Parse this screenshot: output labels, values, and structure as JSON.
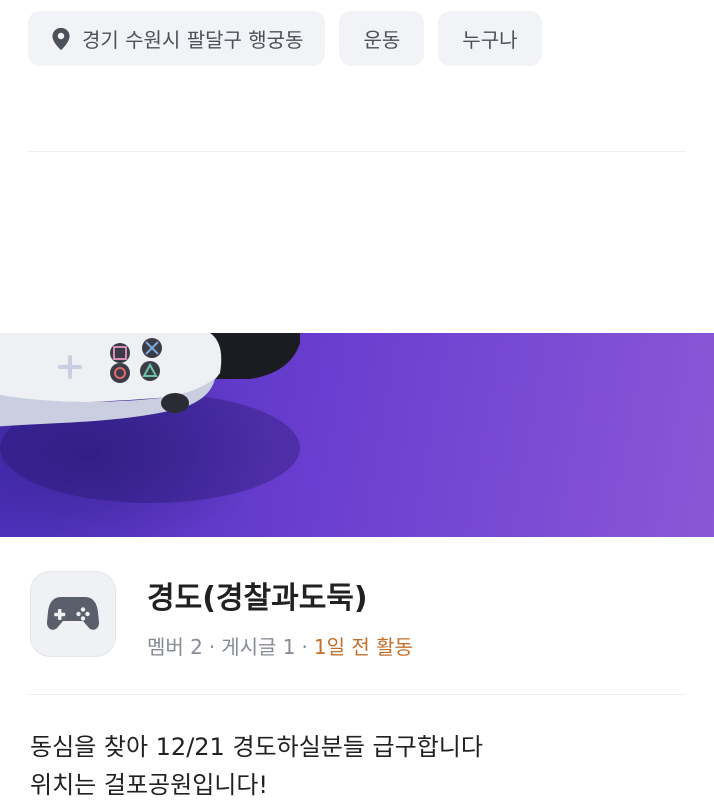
{
  "tags": {
    "location": "경기 수원시 팔달구 행궁동",
    "category": "운동",
    "audience": "누구나",
    "location_icon": "map-pin-icon"
  },
  "banner": {
    "image": "game-controller-on-purple-background"
  },
  "club": {
    "icon": "game-controller-icon",
    "title": "경도(경찰과도둑)",
    "members_label": "멤버 2",
    "posts_label": "게시글 1",
    "activity_label": "1일 전 활동",
    "separator": "·",
    "activity_color": "#c46f2a"
  },
  "description": {
    "line1": "동심을 찾아 12/21 경도하실분들 급구합니다",
    "line2": "위치는 걸포공원입니다!"
  }
}
